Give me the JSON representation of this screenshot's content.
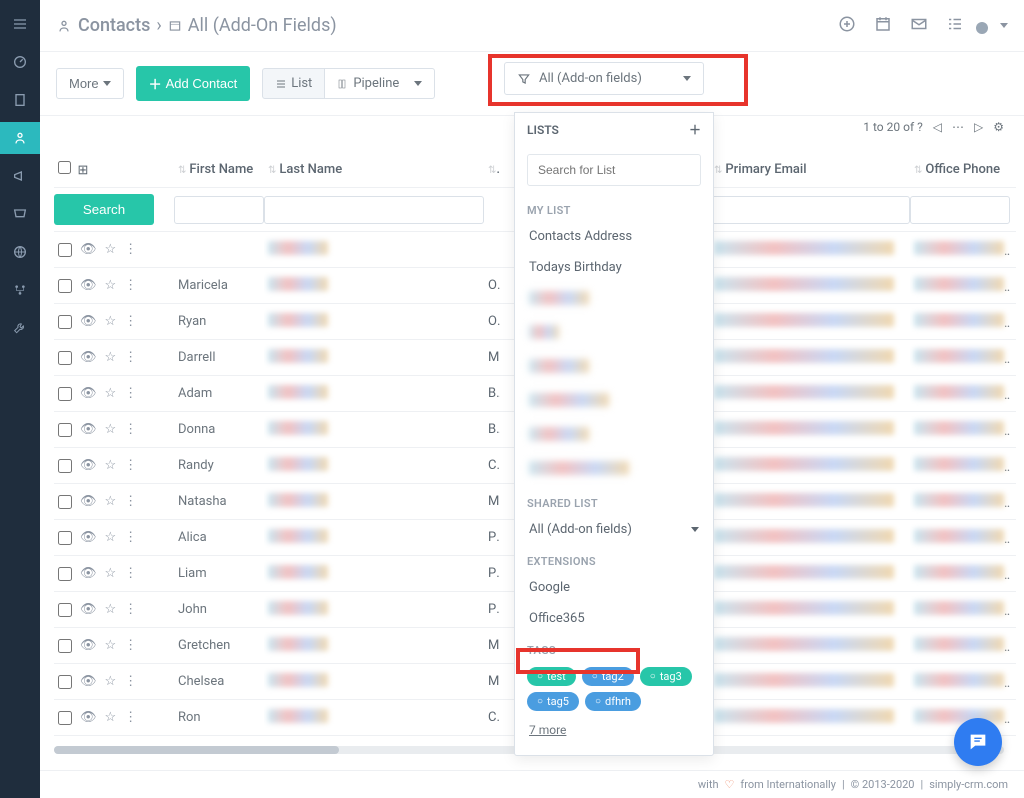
{
  "header": {
    "breadcrumb_main": "Contacts",
    "breadcrumb_sep": "›",
    "breadcrumb_view": "All (Add-On Fields)"
  },
  "toolbar": {
    "more": "More",
    "add_contact": "Add Contact",
    "view_list": "List",
    "view_pipeline": "Pipeline",
    "filter_label": "All (Add-on fields)"
  },
  "pagination": {
    "text": "1 to 20  of  ?"
  },
  "columns": {
    "first_name": "First Name",
    "last_name": "Last Name",
    "title": "T",
    "primary_email": "Primary Email",
    "office_phone": "Office Phone"
  },
  "search_button": "Search",
  "rows": [
    {
      "first": "",
      "title": ""
    },
    {
      "first": "Maricela",
      "title": "Ov"
    },
    {
      "first": "Ryan",
      "title": "Ov"
    },
    {
      "first": "Darrell",
      "title": "Ma\nDir"
    },
    {
      "first": "Adam",
      "title": "Bra\nMa"
    },
    {
      "first": "Donna",
      "title": "Bra\nMa"
    },
    {
      "first": "Randy",
      "title": "CC"
    },
    {
      "first": "Natasha",
      "title": "Ma\nMa"
    },
    {
      "first": "Alica",
      "title": "Pra\nMa"
    },
    {
      "first": "Liam",
      "title": "Pra\nMa"
    },
    {
      "first": "John",
      "title": "Pra\nMa"
    },
    {
      "first": "Gretchen",
      "title": "Ma\nMa"
    },
    {
      "first": "Chelsea",
      "title": "Ma\nDir"
    },
    {
      "first": "Ron",
      "title": "CC"
    }
  ],
  "dropdown": {
    "lists_header": "LISTS",
    "search_placeholder": "Search for List",
    "my_list_label": "MY LIST",
    "my_list_items": [
      "Contacts Address",
      "Todays Birthday"
    ],
    "shared_list_label": "SHARED LIST",
    "shared_item": "All (Add-on fields)",
    "extensions_label": "EXTENSIONS",
    "extensions": [
      "Google",
      "Office365"
    ],
    "tags_label": "TAGS",
    "tags": [
      {
        "label": "test",
        "cls": "green"
      },
      {
        "label": "tag2",
        "cls": "blue"
      },
      {
        "label": "tag3",
        "cls": "green"
      },
      {
        "label": "tag5",
        "cls": "blue"
      },
      {
        "label": "dfhrh",
        "cls": "blue"
      }
    ],
    "more_tags": "7 more"
  },
  "footer": {
    "text_a": "with",
    "text_b": "from Internationally",
    "text_c": "© 2013-2020",
    "text_d": "simply-crm.com"
  }
}
